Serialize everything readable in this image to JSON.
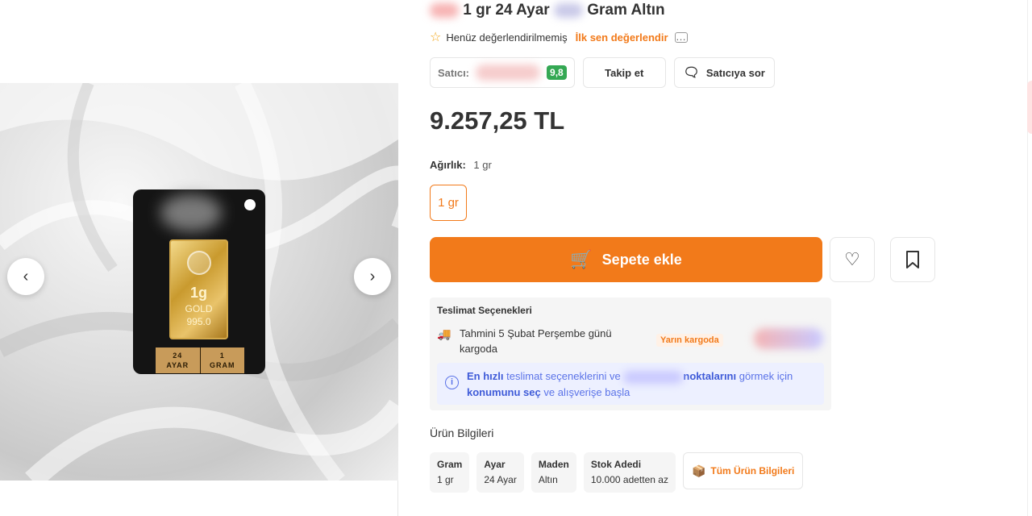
{
  "title": {
    "brand_blurred": "",
    "text_part1": "1 gr 24 Ayar",
    "text_part2": "Gram Altın"
  },
  "rating": {
    "status": "Henüz değerlendirilmemiş",
    "rate_link": "İlk sen değerlendir",
    "star_icon": "star-outline-icon",
    "comment_icon": "comment-icon"
  },
  "seller": {
    "label": "Satıcı:",
    "score": "9,8",
    "follow_label": "Takip et",
    "ask_label": "Satıcıya sor"
  },
  "price": "9.257,25 TL",
  "weight": {
    "label": "Ağırlık:",
    "value": "1 gr",
    "option": "1 gr"
  },
  "actions": {
    "add_to_cart": "Sepete ekle"
  },
  "delivery": {
    "title": "Teslimat Seçenekleri",
    "estimate": "Tahmini 5 Şubat Perşembe günü kargoda",
    "badge": "Yarın kargoda",
    "location_part1": "En hızlı",
    "location_part2": "teslimat seçeneklerini ve",
    "location_part3": "noktalarını",
    "location_part4": "görmek için",
    "location_part5": "konumunu seç",
    "location_part6": "ve alışverişe başla"
  },
  "product_info": {
    "title": "Ürün Bilgileri",
    "attributes": [
      {
        "name": "Gram",
        "value": "1 gr"
      },
      {
        "name": "Ayar",
        "value": "24 Ayar"
      },
      {
        "name": "Maden",
        "value": "Altın"
      },
      {
        "name": "Stok Adedi",
        "value": "10.000 adetten az"
      }
    ],
    "all_info_label": "Tüm Ürün Bilgileri"
  },
  "image": {
    "gold_weight": "1g",
    "gold_text": "GOLD",
    "gold_purity": "995.0",
    "label_left_top": "24",
    "label_left_bottom": "AYAR",
    "label_right_top": "1",
    "label_right_bottom": "GRAM"
  },
  "colors": {
    "accent": "#f27a1a",
    "score": "#34a853",
    "info": "#5b73e8"
  }
}
